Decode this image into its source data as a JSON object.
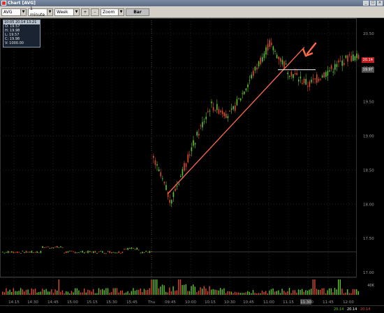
{
  "window": {
    "title": "Chart [AVG]"
  },
  "toolbar": {
    "symbol": "AVG",
    "interval": "1 minute",
    "range": "Week",
    "plus": "+",
    "minus": "-",
    "zoom": "Zoom",
    "bar": "Bar"
  },
  "info_box": {
    "header": "10:05 20:14 13:21",
    "open": "O: 19.57",
    "high": "H: 19.98",
    "low": "L: 19.57",
    "close": "C: 19.98",
    "volume": "V: 1000.00"
  },
  "price_axis": [
    "20.50",
    "20.00",
    "19.50",
    "19.00",
    "18.50",
    "18.00",
    "17.50",
    "17.00"
  ],
  "time_axis": [
    "14:15",
    "14:30",
    "14:45",
    "15:00",
    "15:15",
    "15:30",
    "15:45",
    "Thu",
    "09:45",
    "10:00",
    "10:15",
    "10:30",
    "10:45",
    "11:00",
    "11:15",
    "11:30",
    "11:45",
    "12:00"
  ],
  "current_prices": {
    "red": "20.14",
    "gray": "19.97"
  },
  "volume_label": "40K",
  "status": {
    "a": "20.14",
    "b": "20.14",
    "c": "20.14",
    "time_box": "11:30"
  },
  "colors": {
    "up": "#5fc12a",
    "down": "#d94a2a",
    "trend": "#ff6a4d",
    "grid": "#222222"
  },
  "chart_data": {
    "type": "candlestick",
    "ylim": [
      16.9,
      20.75
    ],
    "annotations": [
      "trendline",
      "horizontal-resistance",
      "arrow"
    ],
    "prev_session_level": 17.3,
    "session_path": [
      {
        "t": "Thu",
        "p": 18.7
      },
      {
        "t": "09:45",
        "p": 18.05
      },
      {
        "t": "10:00",
        "p": 18.8
      },
      {
        "t": "10:15",
        "p": 19.45
      },
      {
        "t": "10:30",
        "p": 19.3
      },
      {
        "t": "10:45",
        "p": 19.8
      },
      {
        "t": "11:00",
        "p": 20.35
      },
      {
        "t": "11:15",
        "p": 19.95
      },
      {
        "t": "11:30",
        "p": 19.75
      },
      {
        "t": "11:45",
        "p": 19.95
      },
      {
        "t": "12:00",
        "p": 20.15
      }
    ]
  }
}
